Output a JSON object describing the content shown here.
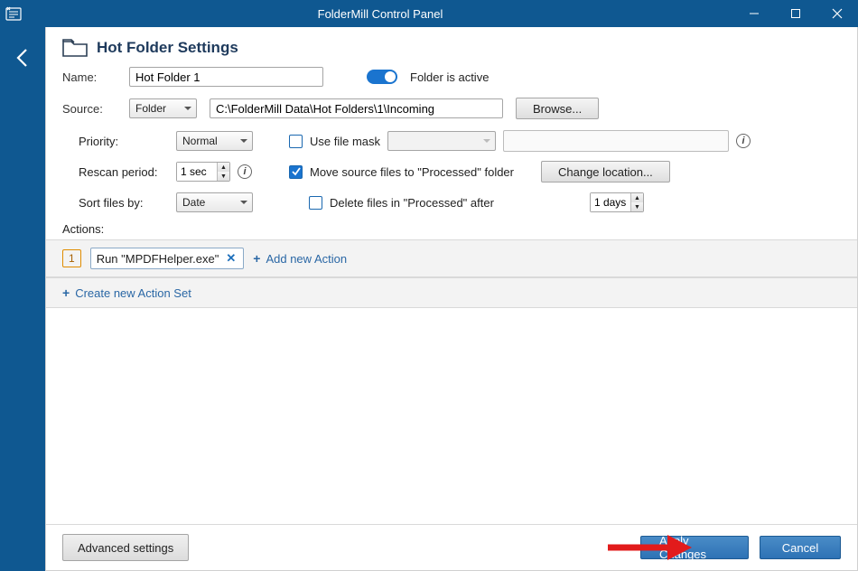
{
  "window": {
    "title": "FolderMill Control Panel"
  },
  "page": {
    "title": "Hot Folder Settings"
  },
  "form": {
    "name_label": "Name:",
    "name_value": "Hot Folder 1",
    "active_label": "Folder is active",
    "source_label": "Source:",
    "source_type": "Folder",
    "source_path": "C:\\FolderMill Data\\Hot Folders\\1\\Incoming",
    "browse_label": "Browse..."
  },
  "opts": {
    "priority_label": "Priority:",
    "priority_value": "Normal",
    "rescan_label": "Rescan period:",
    "rescan_value": "1 sec",
    "sort_label": "Sort files by:",
    "sort_value": "Date",
    "mask_label": "Use file mask",
    "move_label": "Move source files to \"Processed\" folder",
    "change_loc_label": "Change location...",
    "delete_after_label": "Delete files in \"Processed\" after",
    "delete_after_value": "1 days"
  },
  "actions": {
    "label": "Actions:",
    "set_index": "1",
    "chip_text": "Run \"MPDFHelper.exe\"",
    "add_action": "Add new Action",
    "create_set": "Create new Action Set"
  },
  "footer": {
    "advanced": "Advanced settings",
    "apply": "Apply Changes",
    "cancel": "Cancel"
  }
}
